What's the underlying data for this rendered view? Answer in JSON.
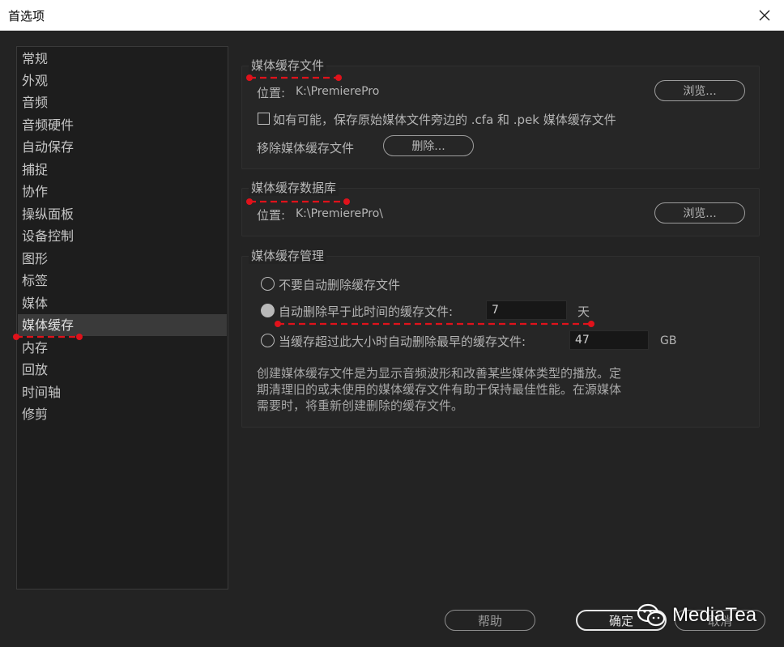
{
  "window": {
    "title": "首选项"
  },
  "sidebar": {
    "items": [
      "常规",
      "外观",
      "音频",
      "音频硬件",
      "自动保存",
      "捕捉",
      "协作",
      "操纵面板",
      "设备控制",
      "图形",
      "标签",
      "媒体",
      "媒体缓存",
      "内存",
      "回放",
      "时间轴",
      "修剪"
    ],
    "selected": "媒体缓存"
  },
  "cache_files": {
    "title": "媒体缓存文件",
    "location_label": "位置:",
    "location_value": "K:\\PremierePro",
    "browse_label": "浏览...",
    "save_beside_label": "如有可能，保存原始媒体文件旁边的 .cfa 和 .pek 媒体缓存文件",
    "save_beside_checked": false,
    "remove_label": "移除媒体缓存文件",
    "delete_label": "删除..."
  },
  "cache_db": {
    "title": "媒体缓存数据库",
    "location_label": "位置:",
    "location_value": "K:\\PremierePro\\",
    "browse_label": "浏览..."
  },
  "cache_mgmt": {
    "title": "媒体缓存管理",
    "options": [
      {
        "label": "不要自动删除缓存文件",
        "checked": false
      },
      {
        "label": "自动删除早于此时间的缓存文件:",
        "checked": true,
        "value": "7",
        "unit": "天"
      },
      {
        "label": "当缓存超过此大小时自动删除最早的缓存文件:",
        "checked": false,
        "value": "47",
        "unit": "GB"
      }
    ],
    "description": [
      "创建媒体缓存文件是为显示音频波形和改善某些媒体类型的播放。定",
      "期清理旧的或未使用的媒体缓存文件有助于保持最佳性能。在源媒体",
      "需要时，将重新创建删除的缓存文件。"
    ]
  },
  "footer": {
    "help": "帮助",
    "ok": "确定",
    "cancel": "取消"
  },
  "watermark": {
    "text": "MediaTea",
    "icon": "wechat-icon"
  },
  "annotation_color": "#e0121b"
}
